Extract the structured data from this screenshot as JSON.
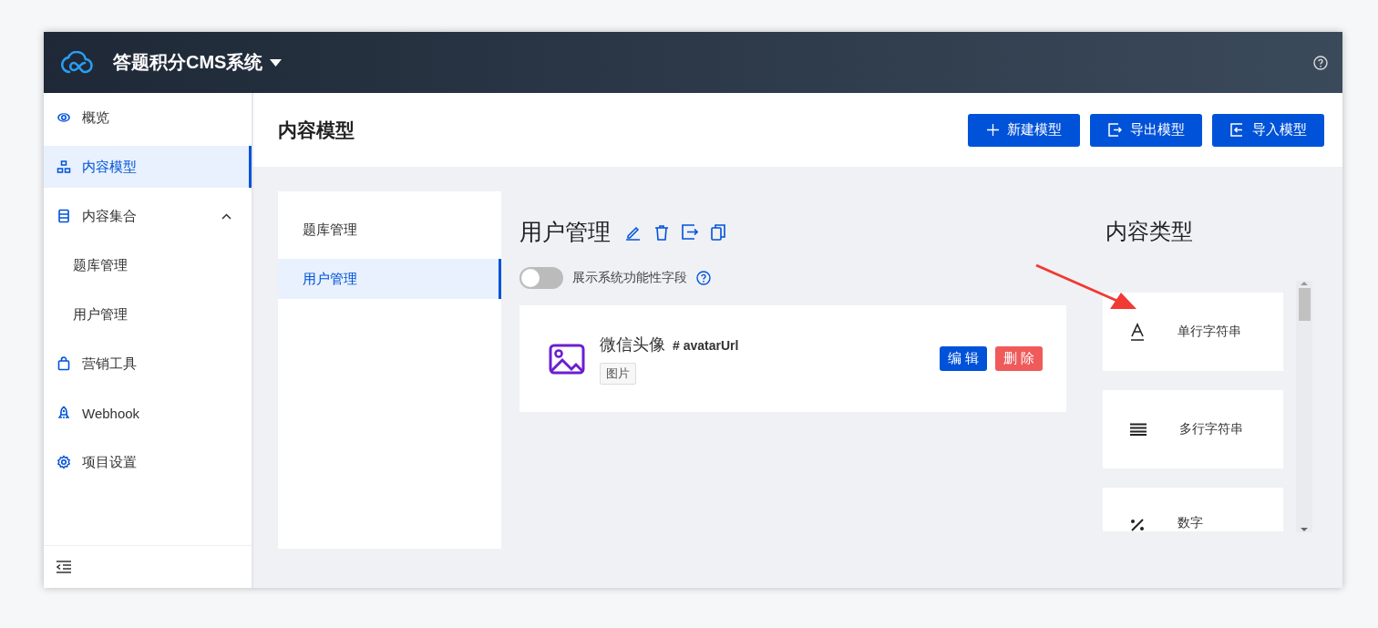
{
  "header": {
    "title": "答题积分CMS系统"
  },
  "sidebar": {
    "items": [
      {
        "label": "概览",
        "selected": false
      },
      {
        "label": "内容模型",
        "selected": true
      },
      {
        "label": "内容集合",
        "selected": false,
        "expanded": true,
        "children": [
          {
            "label": "题库管理",
            "selected": false
          },
          {
            "label": "用户管理",
            "selected": false
          }
        ]
      },
      {
        "label": "营销工具",
        "selected": false
      },
      {
        "label": "Webhook",
        "selected": false
      },
      {
        "label": "项目设置",
        "selected": false
      }
    ]
  },
  "page": {
    "title": "内容模型",
    "buttons": [
      {
        "label": "新建模型",
        "kind": "new"
      },
      {
        "label": "导出模型",
        "kind": "export"
      },
      {
        "label": "导入模型",
        "kind": "import"
      }
    ]
  },
  "models": [
    {
      "label": "题库管理",
      "selected": false
    },
    {
      "label": "用户管理",
      "selected": true
    }
  ],
  "model": {
    "title": "用户管理",
    "toggle": {
      "label": "展示系统功能性字段",
      "on": false
    },
    "fields": [
      {
        "name": "微信头像",
        "key": "# avatarUrl",
        "tag": "图片",
        "actions": [
          "编 辑",
          "删 除"
        ]
      }
    ]
  },
  "content_types": {
    "title": "内容类型",
    "items": [
      {
        "label": "单行字符串",
        "kind": "single_line"
      },
      {
        "label": "多行字符串",
        "kind": "multi_line"
      },
      {
        "label": "数字",
        "kind": "number"
      }
    ]
  }
}
